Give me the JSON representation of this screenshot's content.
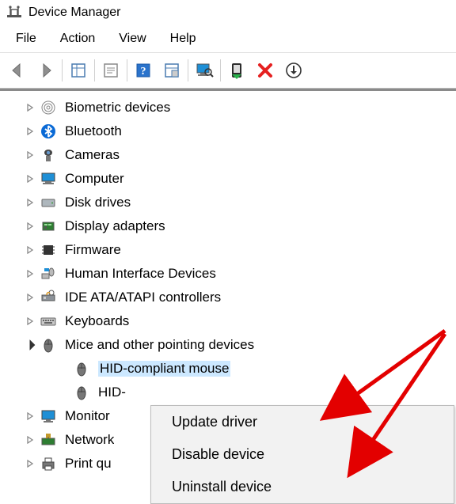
{
  "window": {
    "title": "Device Manager"
  },
  "menu": [
    "File",
    "Action",
    "View",
    "Help"
  ],
  "toolbarButtons": [
    "back",
    "forward",
    "show-details",
    "properties",
    "help",
    "show-hidden",
    "display",
    "install-legacy",
    "delete",
    "down-arrow"
  ],
  "tree": [
    {
      "icon": "biometric",
      "label": "Biometric devices",
      "expandable": true,
      "expanded": false,
      "level": 0
    },
    {
      "icon": "bluetooth",
      "label": "Bluetooth",
      "expandable": true,
      "expanded": false,
      "level": 0
    },
    {
      "icon": "camera",
      "label": "Cameras",
      "expandable": true,
      "expanded": false,
      "level": 0
    },
    {
      "icon": "computer",
      "label": "Computer",
      "expandable": true,
      "expanded": false,
      "level": 0
    },
    {
      "icon": "disk",
      "label": "Disk drives",
      "expandable": true,
      "expanded": false,
      "level": 0
    },
    {
      "icon": "display",
      "label": "Display adapters",
      "expandable": true,
      "expanded": false,
      "level": 0
    },
    {
      "icon": "firmware",
      "label": "Firmware",
      "expandable": true,
      "expanded": false,
      "level": 0
    },
    {
      "icon": "hid",
      "label": "Human Interface Devices",
      "expandable": true,
      "expanded": false,
      "level": 0
    },
    {
      "icon": "ide",
      "label": "IDE ATA/ATAPI controllers",
      "expandable": true,
      "expanded": false,
      "level": 0
    },
    {
      "icon": "keyboard",
      "label": "Keyboards",
      "expandable": true,
      "expanded": false,
      "level": 0
    },
    {
      "icon": "mouse",
      "label": "Mice and other pointing devices",
      "expandable": true,
      "expanded": true,
      "level": 0
    },
    {
      "icon": "mouse",
      "label": "HID-compliant mouse",
      "expandable": false,
      "expanded": false,
      "level": 1,
      "selected": true
    },
    {
      "icon": "mouse",
      "label": "HID-",
      "expandable": false,
      "expanded": false,
      "level": 1
    },
    {
      "icon": "monitor",
      "label": "Monitor",
      "expandable": true,
      "expanded": false,
      "level": 0,
      "truncated": true
    },
    {
      "icon": "network",
      "label": "Network",
      "expandable": true,
      "expanded": false,
      "level": 0,
      "truncated": true
    },
    {
      "icon": "printer",
      "label": "Print qu",
      "expandable": true,
      "expanded": false,
      "level": 0,
      "truncated": true
    }
  ],
  "contextMenu": [
    "Update driver",
    "Disable device",
    "Uninstall device"
  ]
}
